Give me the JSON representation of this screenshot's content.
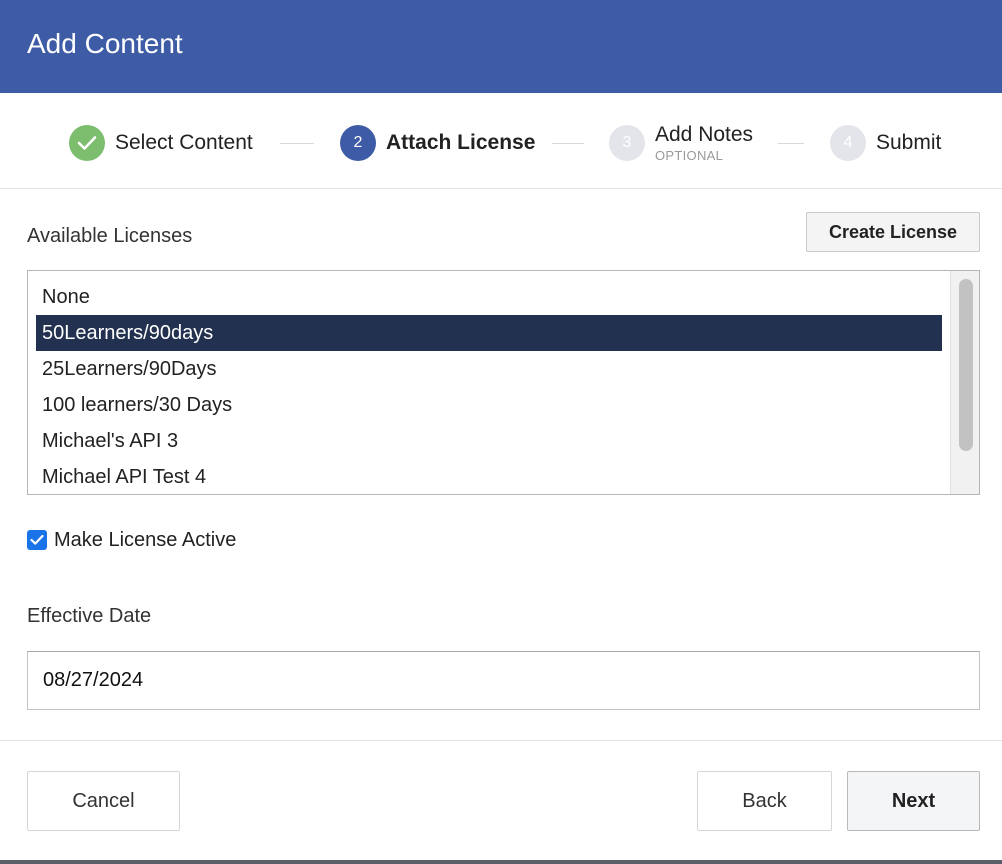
{
  "header": {
    "title": "Add Content"
  },
  "stepper": {
    "steps": [
      {
        "number": "",
        "label": "Select Content",
        "state": "complete",
        "icon": "check-icon"
      },
      {
        "number": "2",
        "label": "Attach License",
        "state": "active"
      },
      {
        "number": "3",
        "label": "Add Notes",
        "sublabel": "OPTIONAL",
        "state": "pending"
      },
      {
        "number": "4",
        "label": "Submit",
        "state": "pending"
      }
    ]
  },
  "licenses": {
    "label": "Available Licenses",
    "create_button": "Create License",
    "options": [
      "None",
      "50Learners/90days",
      "25Learners/90Days",
      "100 learners/30 Days",
      "Michael's API 3",
      "Michael API Test 4"
    ],
    "selected": "50Learners/90days"
  },
  "make_active": {
    "label": "Make License Active",
    "checked": true
  },
  "effective_date": {
    "label": "Effective Date",
    "value": "08/27/2024"
  },
  "footer": {
    "cancel_label": "Cancel",
    "back_label": "Back",
    "next_label": "Next"
  },
  "colors": {
    "header": "#3e5ba6",
    "step_complete": "#7cbd6e",
    "step_active": "#3e5ba6",
    "step_pending": "#e3e5ea",
    "selected_row": "#22314f",
    "checkbox": "#1a73e8"
  }
}
